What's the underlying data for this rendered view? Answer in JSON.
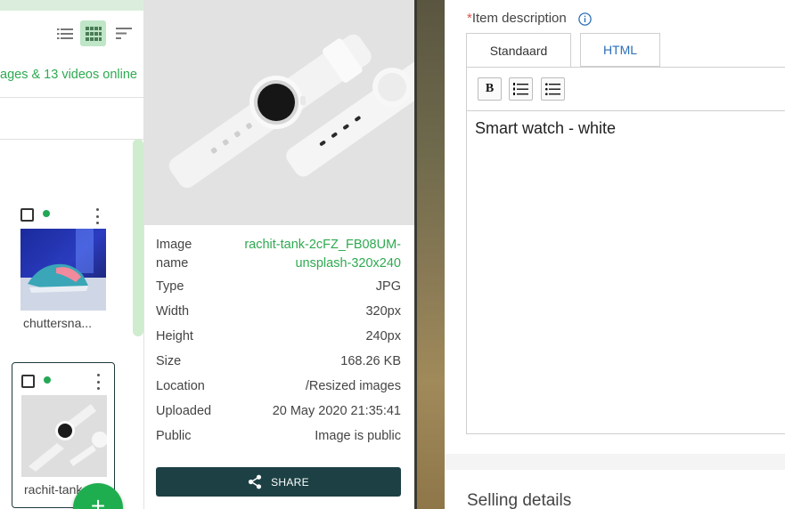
{
  "library": {
    "count_text": "ages & 13 videos online",
    "view_modes": [
      "list",
      "grid",
      "sort"
    ],
    "items": [
      {
        "label": "chuttersna...",
        "status_color": "#23a855",
        "selected": false
      },
      {
        "label": "rachit-tank",
        "status_color": "#23a855",
        "selected": true
      }
    ]
  },
  "details": {
    "rows": [
      {
        "key": "Image name",
        "value": "rachit-tank-2cFZ_FB08UM-unsplash-320x240"
      },
      {
        "key": "Type",
        "value": "JPG"
      },
      {
        "key": "Width",
        "value": "320px"
      },
      {
        "key": "Height",
        "value": "240px"
      },
      {
        "key": "Size",
        "value": "168.26 KB"
      },
      {
        "key": "Location",
        "value": "/Resized images"
      },
      {
        "key": "Uploaded",
        "value": "20 May 2020 21:35:41"
      },
      {
        "key": "Public",
        "value": "Image is public"
      }
    ],
    "name_key_line1": "Image",
    "name_key_line2": "name",
    "name_value_line1": "rachit-tank-2cFZ_FB08UM-",
    "name_value_line2": "unsplash-320x240",
    "share_label": "SHARE"
  },
  "form": {
    "required_marker": "*",
    "description_label": "Item description",
    "tabs": [
      {
        "label": "Standaard",
        "active": true
      },
      {
        "label": "HTML",
        "active": false
      }
    ],
    "toolbar": [
      "bold",
      "ordered-list",
      "unordered-list"
    ],
    "bold_label": "B",
    "content": "Smart watch - white",
    "next_section_title": "Selling details"
  },
  "colors": {
    "accent_green": "#2eaa50",
    "share_button": "#1c4044",
    "link_blue": "#2a6fb8",
    "required_red": "#d9534f"
  }
}
